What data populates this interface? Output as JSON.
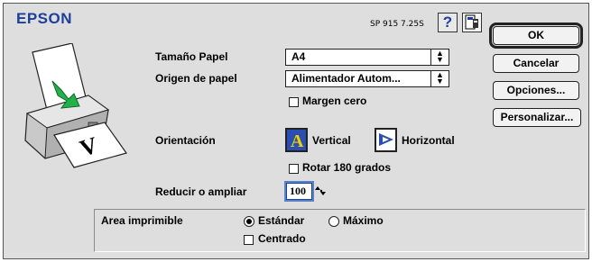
{
  "header": {
    "brand": "EPSON",
    "version": "SP 915 7.25S",
    "help_symbol": "?"
  },
  "buttons": {
    "ok": "OK",
    "cancel": "Cancelar",
    "options": "Opciones...",
    "customize": "Personalizar..."
  },
  "paper_size": {
    "label": "Tamaño Papel",
    "value": "A4"
  },
  "paper_source": {
    "label": "Origen de papel",
    "value": "Alimentador Autom...",
    "zero_margin_label": "Margen cero",
    "zero_margin_checked": false
  },
  "orientation": {
    "label": "Orientación",
    "portrait_label": "Vertical",
    "landscape_label": "Horizontal",
    "selected": "Vertical",
    "rotate_label": "Rotar 180 grados",
    "rotate_checked": false
  },
  "reduce": {
    "label": "Reducir o ampliar",
    "value": "100"
  },
  "printable_area": {
    "label": "Area imprimible",
    "standard_label": "Estándar",
    "maximum_label": "Máximo",
    "selected": "Estándar",
    "centered_label": "Centrado",
    "centered_checked": false
  },
  "icons": {
    "help": "help-icon",
    "utility": "utility-icon",
    "printer": "printer-illustration",
    "portrait": "portrait-orientation-icon",
    "landscape": "landscape-orientation-icon",
    "stepper": "stepper-icon",
    "popup_arrow": "popup-arrow-icon"
  },
  "colors": {
    "brand": "#1c3f9a",
    "dialog_bg": "#dedede",
    "arrow_green": "#22b04a"
  }
}
